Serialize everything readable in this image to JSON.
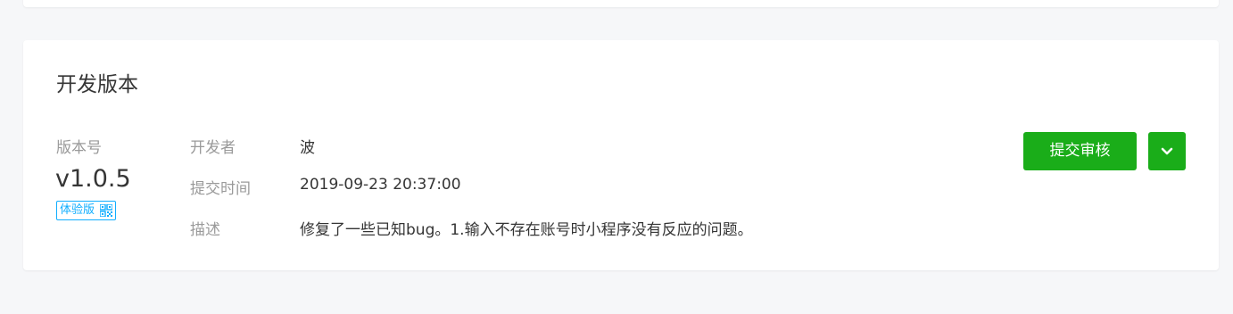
{
  "dev_version": {
    "title": "开发版本",
    "version_label": "版本号",
    "version_number": "v1.0.5",
    "version_tag": "体验版",
    "fields": [
      {
        "key": "开发者",
        "value": "波"
      },
      {
        "key": "提交时间",
        "value": "2019-09-23 20:37:00"
      },
      {
        "key": "描述",
        "value": "修复了一些已知bug。1.输入不存在账号时小程序没有反应的问题。"
      }
    ],
    "submit_label": "提交审核"
  },
  "icons": {
    "qr": "qr-code-icon",
    "dropdown": "chevron-down-icon"
  },
  "colors": {
    "primary_green": "#1aad19",
    "tag_blue": "#10aeff",
    "text_main": "#353535",
    "text_muted": "#9a9a9a",
    "page_bg": "#f6f7f9"
  }
}
